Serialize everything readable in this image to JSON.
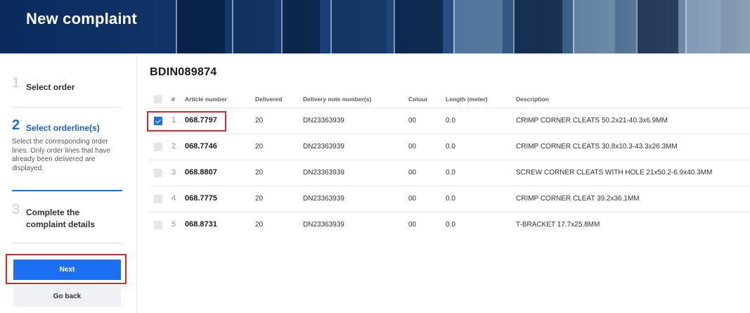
{
  "header": {
    "title": "New complaint"
  },
  "steps": [
    {
      "number": "1",
      "label": "Select order"
    },
    {
      "number": "2",
      "label": "Select orderline(s)",
      "description": "Select the corresponding order lines. Only order lines that have already been delivered are displayed."
    },
    {
      "number": "3",
      "label_line1": "Complete the",
      "label_line2": "complaint details"
    }
  ],
  "buttons": {
    "next": "Next",
    "back": "Go back"
  },
  "order": {
    "id": "BDIN089874"
  },
  "table": {
    "headers": {
      "index": "#",
      "article": "Article number",
      "delivered": "Delivered",
      "delivery_note": "Delivery note number(s)",
      "colour": "Colour",
      "length": "Length (meter)",
      "description": "Description"
    },
    "rows": [
      {
        "index": "1",
        "article": "068.7797",
        "delivered": "20",
        "delivery_note": "DN23363939",
        "colour": "00",
        "length": "0.0",
        "description": "CRIMP CORNER CLEATS 50.2x21-40.3x6.9MM",
        "selected": true
      },
      {
        "index": "2",
        "article": "068.7746",
        "delivered": "20",
        "delivery_note": "DN23363939",
        "colour": "00",
        "length": "0.0",
        "description": "CRIMP CORNER CLEATS 30.8x10.3-43.3x26.3MM",
        "selected": false
      },
      {
        "index": "3",
        "article": "068.8807",
        "delivered": "20",
        "delivery_note": "DN23363939",
        "colour": "00",
        "length": "0.0",
        "description": "SCREW CORNER CLEATS WITH HOLE 21x50.2-6.9x40.3MM",
        "selected": false
      },
      {
        "index": "4",
        "article": "068.7775",
        "delivered": "20",
        "delivery_note": "DN23363939",
        "colour": "00",
        "length": "0.0",
        "description": "CRIMP CORNER CLEAT 39.2x36.1MM",
        "selected": false
      },
      {
        "index": "5",
        "article": "068.8731",
        "delivered": "20",
        "delivery_note": "DN23363939",
        "colour": "00",
        "length": "0.0",
        "description": "T-BRACKET 17.7x25.8MM",
        "selected": false
      }
    ]
  },
  "colors": {
    "accent": "#1c6ff0",
    "highlight": "#e0262b",
    "banner": "#0a2a5c"
  }
}
